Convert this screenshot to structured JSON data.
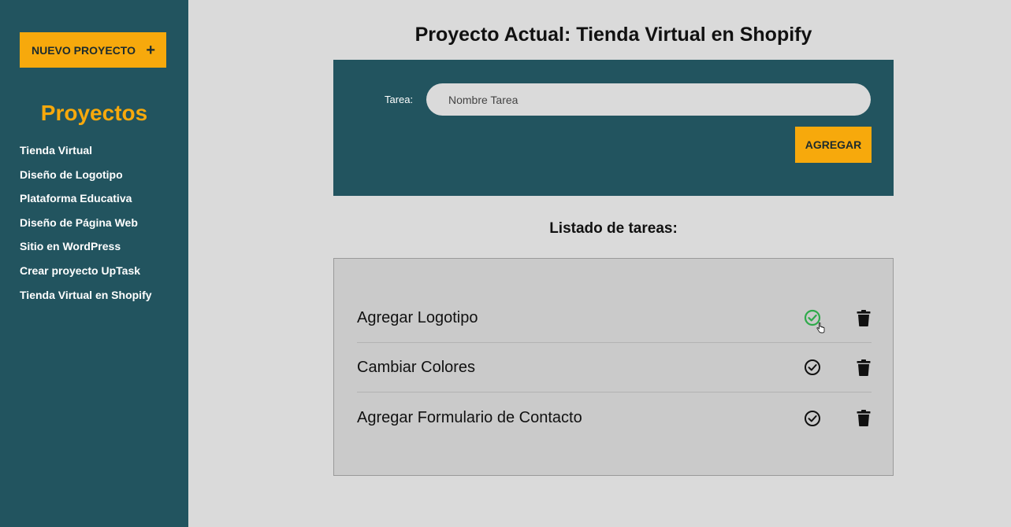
{
  "sidebar": {
    "new_project_label": "NUEVO PROYECTO",
    "plus_symbol": "+",
    "title": "Proyectos",
    "projects": [
      {
        "label": "Tienda Virtual"
      },
      {
        "label": "Diseño de Logotipo"
      },
      {
        "label": "Plataforma Educativa"
      },
      {
        "label": "Diseño de Página Web"
      },
      {
        "label": "Sitio en WordPress"
      },
      {
        "label": "Crear proyecto UpTask"
      },
      {
        "label": "Tienda Virtual en Shopify"
      }
    ]
  },
  "header": {
    "title_label": "Proyecto Actual:",
    "project_name": "Tienda Virtual en Shopify"
  },
  "form": {
    "field_label": "Tarea:",
    "input_placeholder": "Nombre Tarea",
    "input_value": "",
    "submit_label": "AGREGAR"
  },
  "task_list": {
    "heading": "Listado de tareas:",
    "tasks": [
      {
        "name": "Agregar Logotipo",
        "check_state": "hover",
        "check_icon": "check-circle-icon",
        "delete_icon": "trash-icon"
      },
      {
        "name": "Cambiar Colores",
        "check_state": "normal",
        "check_icon": "check-circle-icon",
        "delete_icon": "trash-icon"
      },
      {
        "name": "Agregar Formulario de Contacto",
        "check_state": "normal",
        "check_icon": "check-circle-icon",
        "delete_icon": "trash-icon"
      }
    ]
  },
  "colors": {
    "sidebar_bg": "#22545f",
    "accent": "#f7a90c",
    "page_bg": "#dadada",
    "task_box_bg": "#cacaca",
    "check_hover": "#2eaa4a",
    "icon_dark": "#111111"
  }
}
